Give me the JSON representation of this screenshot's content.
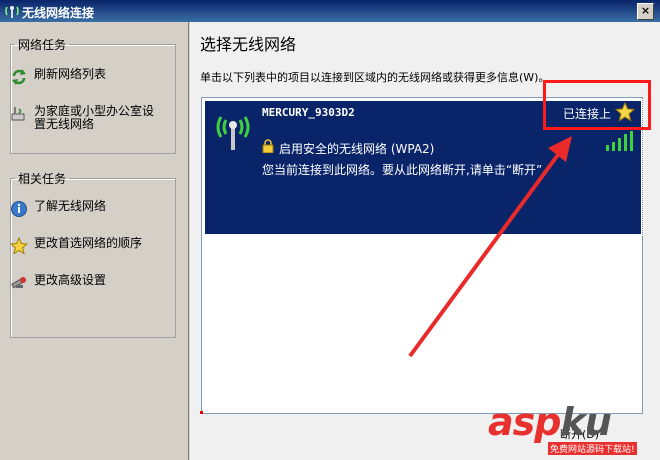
{
  "window": {
    "title": "无线网络连接",
    "close_label": "×"
  },
  "left_pane": {
    "network_tasks": {
      "title": "网络任务",
      "items": [
        {
          "label": "刷新网络列表",
          "icon": "refresh-icon"
        },
        {
          "label": "为家庭或小型办公室设置无线网络",
          "icon": "wireless-setup-icon"
        }
      ]
    },
    "related_tasks": {
      "title": "相关任务",
      "items": [
        {
          "label": "了解无线网络",
          "icon": "info-icon"
        },
        {
          "label": "更改首选网络的顺序",
          "icon": "star-icon"
        },
        {
          "label": "更改高级设置",
          "icon": "settings-icon"
        }
      ]
    }
  },
  "main": {
    "heading": "选择无线网络",
    "description": "单击以下列表中的项目以连接到区域内的无线网络或获得更多信息(W)。",
    "networks": [
      {
        "ssid": "MERCURY_9303D2",
        "status": "已连接上",
        "security": "启用安全的无线网络 (WPA2)",
        "info": "您当前连接到此网络。要从此网络断开,请单击“断开”。",
        "signal_bars": 5
      }
    ],
    "bottom_text": "断开(D)"
  },
  "watermark": {
    "brand_asp": "asp",
    "brand_ku": "ku",
    "tagline": "免费网站源码下载站!"
  },
  "colors": {
    "selection": "#0a246a",
    "highlight_box": "#ff1a1a",
    "arrow": "#ea2a2a"
  }
}
